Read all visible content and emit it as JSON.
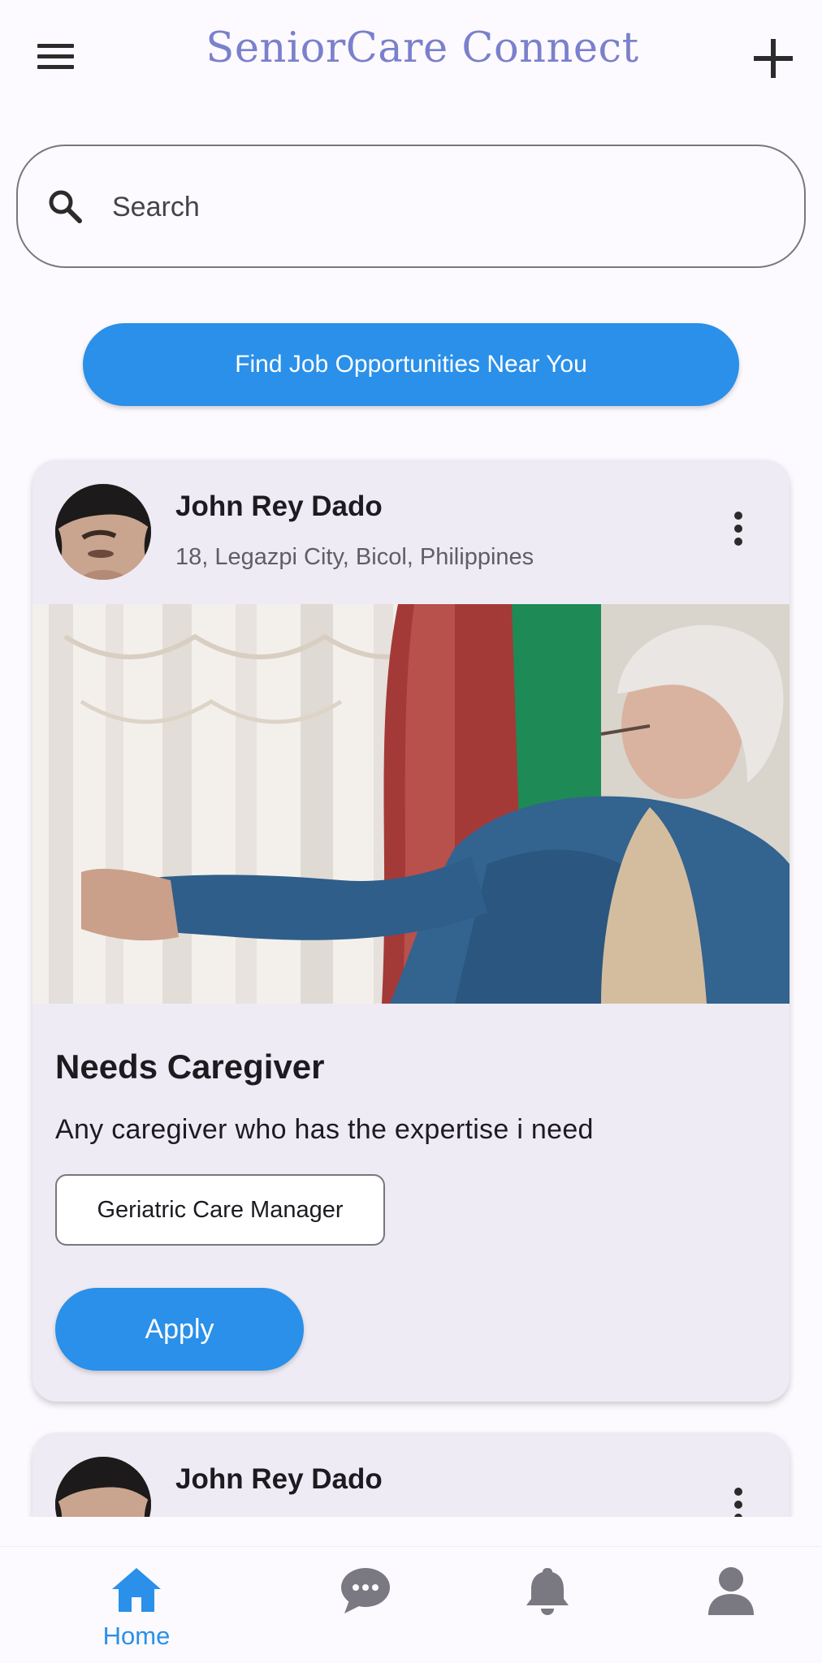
{
  "app": {
    "title": "SeniorCare Connect"
  },
  "appbar": {
    "menu_icon": "menu-icon",
    "add_icon": "add-icon"
  },
  "search": {
    "placeholder": "Search",
    "icon": "search-icon"
  },
  "find_jobs": {
    "label": "Find Job Opportunities Near You"
  },
  "posts": [
    {
      "name": "John Rey Dado",
      "location": "18, Legazpi City, Bicol, Philippines",
      "title": "Needs Caregiver",
      "description": "Any caregiver who has the expertise i need",
      "tag": "Geriatric Care Manager",
      "apply_label": "Apply"
    },
    {
      "name": "John Rey Dado"
    }
  ],
  "bottom_nav": {
    "items": [
      {
        "icon": "home-icon",
        "label": "Home",
        "active": true
      },
      {
        "icon": "chat-icon",
        "label": "",
        "active": false
      },
      {
        "icon": "bell-icon",
        "label": "",
        "active": false
      },
      {
        "icon": "person-icon",
        "label": "",
        "active": false
      }
    ]
  },
  "colors": {
    "primary": "#2a90e9",
    "title": "#7a80cc",
    "card_bg": "#efebf4",
    "icon_inactive": "#7a7880",
    "page_bg": "#fcfafe"
  }
}
